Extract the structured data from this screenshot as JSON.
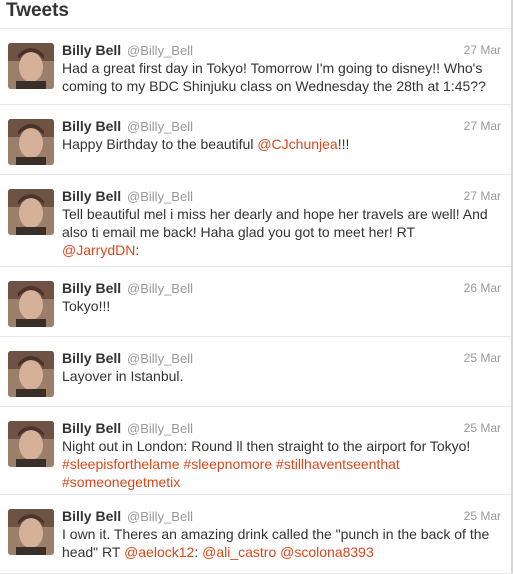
{
  "header": {
    "title": "Tweets"
  },
  "tweets": [
    {
      "name": "Billy Bell",
      "handle": "@Billy_Bell",
      "date": "27 Mar",
      "parts": [
        {
          "text": "Had a great first day in Tokyo! Tomorrow I'm going to disney!! Who's coming to my BDC Shinjuku class on Wednesday the 28th at 1:45??"
        }
      ]
    },
    {
      "name": "Billy Bell",
      "handle": "@Billy_Bell",
      "date": "27 Mar",
      "parts": [
        {
          "text": "Happy Birthday to the beautiful "
        },
        {
          "text": "@CJchunjea",
          "link": true
        },
        {
          "text": "!!!"
        }
      ]
    },
    {
      "name": "Billy Bell",
      "handle": "@Billy_Bell",
      "date": "27 Mar",
      "parts": [
        {
          "text": "Tell beautiful mel i miss her dearly and hope her travels are well! And also ti email me back! Haha glad you got to meet her! RT "
        },
        {
          "text": "@JarrydDN",
          "link": true
        },
        {
          "text": ":"
        }
      ]
    },
    {
      "name": "Billy Bell",
      "handle": "@Billy_Bell",
      "date": "26 Mar",
      "parts": [
        {
          "text": "Tokyo!!!"
        }
      ]
    },
    {
      "name": "Billy Bell",
      "handle": "@Billy_Bell",
      "date": "25 Mar",
      "parts": [
        {
          "text": "Layover in Istanbul."
        }
      ]
    },
    {
      "name": "Billy Bell",
      "handle": "@Billy_Bell",
      "date": "25 Mar",
      "parts": [
        {
          "text": "Night out in London: Round ll then straight to the airport for Tokyo! "
        },
        {
          "text": "#sleepisforthelame",
          "link": true
        },
        {
          "text": " "
        },
        {
          "text": "#sleepnomore",
          "link": true
        },
        {
          "text": " "
        },
        {
          "text": "#stillhaventseenthat",
          "link": true
        },
        {
          "text": " "
        },
        {
          "text": "#someonegetmetix",
          "link": true
        }
      ]
    },
    {
      "name": "Billy Bell",
      "handle": "@Billy_Bell",
      "date": "25 Mar",
      "parts": [
        {
          "text": "I own it. Theres an amazing drink called the \"punch in the back of the head\" RT "
        },
        {
          "text": "@aelock12",
          "link": true
        },
        {
          "text": ": "
        },
        {
          "text": "@ali_castro",
          "link": true
        },
        {
          "text": " "
        },
        {
          "text": "@scolona8393",
          "link": true
        }
      ]
    }
  ],
  "colors": {
    "link": "#d9471a",
    "muted": "#999999",
    "text": "#333333"
  }
}
